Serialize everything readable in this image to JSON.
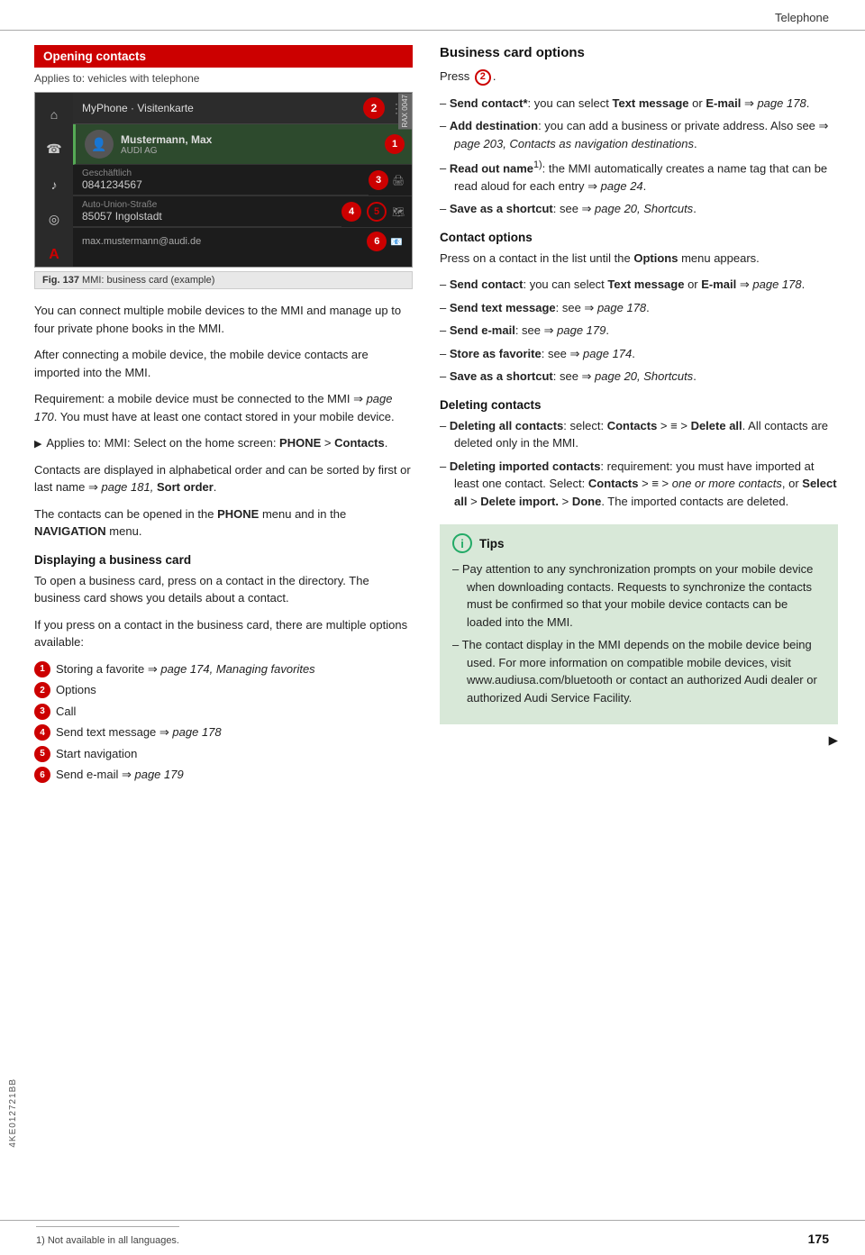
{
  "header": {
    "title": "Telephone"
  },
  "left_margin": {
    "text": "4KE012721BB"
  },
  "left_column": {
    "section_header": "Opening contacts",
    "applies_to": "Applies to: vehicles with telephone",
    "mmi": {
      "title": "MyPhone · Visitenkarte",
      "badge_top": "2",
      "tag_id": "RAX 0047",
      "contact_name": "Mustermann, Max",
      "contact_sub": "AUDI AG",
      "badge1": "1",
      "detail1_label": "Geschäftlich",
      "detail1_value": "0841234567",
      "badge3": "3",
      "detail2_label": "Auto-Union-Straße",
      "detail2_value": "85057 Ingolstadt",
      "badge4": "4",
      "badge5": "5",
      "email": "max.mustermann@audi.de",
      "badge6": "6"
    },
    "fig_caption": "Fig. 137",
    "fig_desc": "MMI: business card (example)",
    "paragraphs": [
      "You can connect multiple mobile devices to the MMI and manage up to four private phone books in the MMI.",
      "After connecting a mobile device, the mobile device contacts are imported into the MMI.",
      "Requirement: a mobile device must be connected to the MMI ⇒ page 170. You must have at least one contact stored in your mobile device.",
      "▶ Applies to: MMI: Select on the home screen: PHONE > Contacts.",
      "Contacts are displayed in alphabetical order and can be sorted by first or last name ⇒ page 181, Sort order.",
      "The contacts can be opened in the PHONE menu and in the NAVIGATION menu."
    ],
    "display_section_title": "Displaying a business card",
    "display_para": "To open a business card, press on a contact in the directory. The business card shows you details about a contact.",
    "if_press_para": "If you press on a contact in the business card, there are multiple options available:",
    "options_list": [
      {
        "num": "1",
        "text": "Storing a favorite ⇒ page 174, Managing favorites"
      },
      {
        "num": "2",
        "text": "Options"
      },
      {
        "num": "3",
        "text": "Call"
      },
      {
        "num": "4",
        "text": "Send text message ⇒ page 178"
      },
      {
        "num": "5",
        "text": "Start navigation"
      },
      {
        "num": "6",
        "text": "Send e-mail ⇒ page 179"
      }
    ]
  },
  "right_column": {
    "business_card_title": "Business card options",
    "press_text": "Press",
    "press_num": "2",
    "dash_items_business": [
      {
        "bold_start": "Send contact*",
        "rest": ": you can select Text message or E-mail ⇒ page 178."
      },
      {
        "bold_start": "Add destination",
        "rest": ": you can add a business or private address. Also see ⇒ page 203, Contacts as navigation destinations."
      },
      {
        "bold_start": "Read out name",
        "rest": "1): the MMI automatically creates a name tag that can be read aloud for each entry ⇒ page 24."
      },
      {
        "bold_start": "Save as a shortcut",
        "rest": ": see ⇒ page 20, Shortcuts."
      }
    ],
    "contact_options_title": "Contact options",
    "contact_options_intro": "Press on a contact in the list until the Options menu appears.",
    "dash_items_contact": [
      {
        "bold_start": "Send contact",
        "rest": ": you can select Text message or E-mail ⇒ page 178."
      },
      {
        "bold_start": "Send text message",
        "rest": ": see ⇒ page 178."
      },
      {
        "bold_start": "Send e-mail",
        "rest": ": see ⇒ page 179."
      },
      {
        "bold_start": "Store as favorite",
        "rest": ": see ⇒ page 174."
      },
      {
        "bold_start": "Save as a shortcut",
        "rest": ": see ⇒ page 20, Shortcuts."
      }
    ],
    "deleting_title": "Deleting contacts",
    "dash_items_deleting": [
      {
        "bold_start": "Deleting all contacts",
        "rest": ": select: Contacts > ≡ > Delete all. All contacts are deleted only in the MMI."
      },
      {
        "bold_start": "Deleting imported contacts",
        "rest": ": requirement: you must have imported at least one contact. Select: Contacts > ≡ > one or more contacts, or Select all > Delete import. > Done. The imported contacts are deleted."
      }
    ],
    "tips_title": "Tips",
    "tips_items": [
      "Pay attention to any synchronization prompts on your mobile device when downloading contacts. Requests to synchronize the contacts must be confirmed so that your mobile device contacts can be loaded into the MMI.",
      "The contact display in the MMI depends on the mobile device being used. For more information on compatible mobile devices, visit www.audiusa.com/bluetooth or contact an authorized Audi dealer or authorized Audi Service Facility."
    ]
  },
  "footer": {
    "footnote": "1)  Not available in all languages.",
    "page_number": "175",
    "next_arrow": "▶"
  }
}
